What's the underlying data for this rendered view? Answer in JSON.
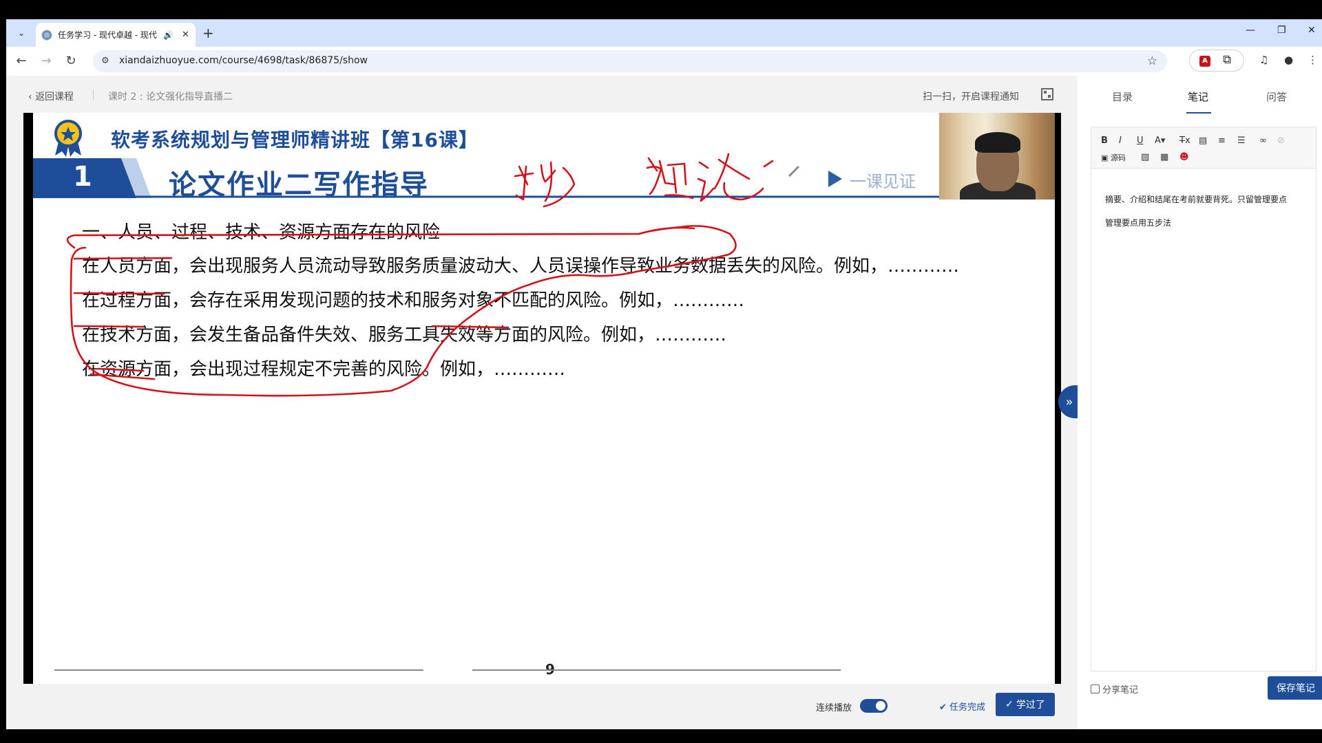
{
  "browser": {
    "tab_title": "任务学习 - 现代卓越 - 现代",
    "url": "xiandaizhuoyue.com/course/4698/task/86875/show"
  },
  "header": {
    "back_label": "返回课程",
    "lesson_title": "课时 2 : 论文强化指导直播二",
    "scan_text": "扫一扫，开启课程通知"
  },
  "slide": {
    "course_title": "软考系统规划与管理师精讲班【第16课】",
    "section_number": "1",
    "section_title": "论文作业二写作指导",
    "logo_text": "一课见证",
    "heading": "一、人员、过程、技术、资源方面存在的风险",
    "lines": [
      "在人员方面，会出现服务人员流动导致服务质量波动大、人员误操作导致业务数据丢失的风险。例如，…………",
      "在过程方面，会存在采用发现问题的技术和服务对象不匹配的风险。例如，…………",
      "在技术方面，会发生备品备件失效、服务工具失效等方面的风险。例如，…………",
      "在资源方面，会出现过程规定不完善的风险。例如，…………"
    ],
    "page_number": "9"
  },
  "controls": {
    "autoplay_label": "连续播放",
    "task_done_label": "任务完成",
    "learned_label": "学过了"
  },
  "side": {
    "tabs": [
      "目录",
      "笔记",
      "问答"
    ],
    "active_tab": "笔记",
    "source_label": "源码",
    "note_lines": [
      "摘要、介绍和结尾在考前就要背死。只留管理要点",
      "管理要点用五步法"
    ],
    "share_label": "分享笔记",
    "save_label": "保存笔记"
  },
  "colors": {
    "accent": "#1e4e9a",
    "ink": "#d3121b"
  }
}
